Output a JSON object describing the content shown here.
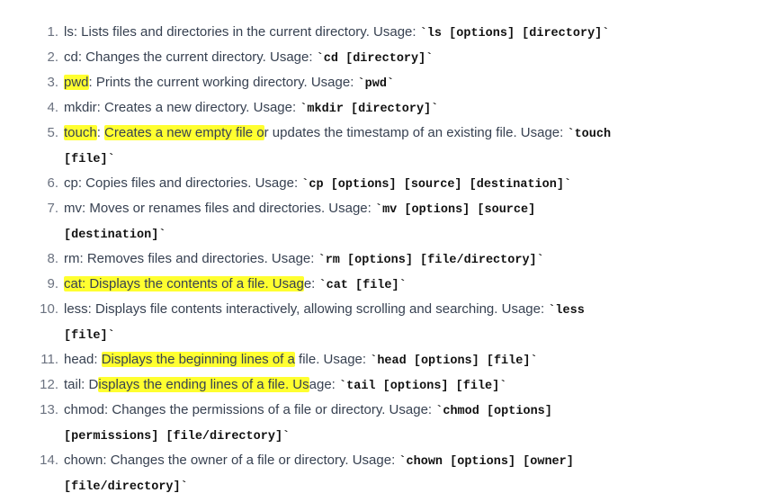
{
  "items": [
    {
      "num": "1.",
      "lines": [
        [
          {
            "t": "ls: Lists files and directories in the current directory. Usage: "
          },
          {
            "t": "`ls [options] [directory]`",
            "code": true
          }
        ]
      ]
    },
    {
      "num": "2.",
      "lines": [
        [
          {
            "t": "cd: Changes the current directory. Usage: "
          },
          {
            "t": "`cd [directory]`",
            "code": true
          }
        ]
      ]
    },
    {
      "num": "3.",
      "lines": [
        [
          {
            "t": "pwd",
            "hl": true
          },
          {
            "t": ": Prints the current working directory. Usage: "
          },
          {
            "t": "`pwd`",
            "code": true
          }
        ]
      ]
    },
    {
      "num": "4.",
      "lines": [
        [
          {
            "t": "mkdir: Creates a new directory. Usage: "
          },
          {
            "t": "`mkdir [directory]`",
            "code": true
          }
        ]
      ]
    },
    {
      "num": "5.",
      "lines": [
        [
          {
            "t": "touch",
            "hl": true
          },
          {
            "t": ": "
          },
          {
            "t": "Creates a new empty file o",
            "hl": true
          },
          {
            "t": "r updates the timestamp of an existing file. Usage: "
          },
          {
            "t": "`touch",
            "code": true
          }
        ],
        [
          {
            "t": "[file]`",
            "code": true
          }
        ]
      ]
    },
    {
      "num": "6.",
      "lines": [
        [
          {
            "t": "cp: Copies files and directories. Usage: "
          },
          {
            "t": "`cp [options] [source] [destination]`",
            "code": true
          }
        ]
      ]
    },
    {
      "num": "7.",
      "lines": [
        [
          {
            "t": "mv: Moves or renames files and directories. Usage: "
          },
          {
            "t": "`mv [options] [source]",
            "code": true
          }
        ],
        [
          {
            "t": "[destination]`",
            "code": true
          }
        ]
      ]
    },
    {
      "num": "8.",
      "lines": [
        [
          {
            "t": "rm: Removes files and directories. Usage: "
          },
          {
            "t": "`rm [options] [file/directory]`",
            "code": true
          }
        ]
      ]
    },
    {
      "num": "9.",
      "lines": [
        [
          {
            "t": "cat: Displays the contents of a file. Usag",
            "hl": true
          },
          {
            "t": "e: "
          },
          {
            "t": "`cat [file]`",
            "code": true
          }
        ]
      ]
    },
    {
      "num": "10.",
      "lines": [
        [
          {
            "t": "less: Displays file contents interactively, allowing scrolling and searching. Usage: "
          },
          {
            "t": "`less",
            "code": true
          }
        ],
        [
          {
            "t": "[file]`",
            "code": true
          }
        ]
      ]
    },
    {
      "num": "11.",
      "lines": [
        [
          {
            "t": "head: "
          },
          {
            "t": "Displays the beginning lines of a",
            "hl": true
          },
          {
            "t": " file. Usage: "
          },
          {
            "t": "`head [options] [file]`",
            "code": true
          }
        ]
      ]
    },
    {
      "num": "12.",
      "lines": [
        [
          {
            "t": "tail: D"
          },
          {
            "t": "isplays the ending lines of a file. Us",
            "hl": true
          },
          {
            "t": "age: "
          },
          {
            "t": "`tail [options] [file]`",
            "code": true
          }
        ]
      ]
    },
    {
      "num": "13.",
      "lines": [
        [
          {
            "t": "chmod: Changes the permissions of a file or directory. Usage: "
          },
          {
            "t": "`chmod [options]",
            "code": true
          }
        ],
        [
          {
            "t": "[permissions] [file/directory]`",
            "code": true
          }
        ]
      ]
    },
    {
      "num": "14.",
      "lines": [
        [
          {
            "t": "chown: Changes the owner of a file or directory. Usage: "
          },
          {
            "t": "`chown [options] [owner]",
            "code": true
          }
        ],
        [
          {
            "t": "[file/directory]`",
            "code": true
          }
        ]
      ]
    }
  ],
  "colors": {
    "text": "#374151",
    "number": "#6b7280",
    "code": "#111111",
    "highlight": "#ffff30",
    "background": "#ffffff"
  }
}
